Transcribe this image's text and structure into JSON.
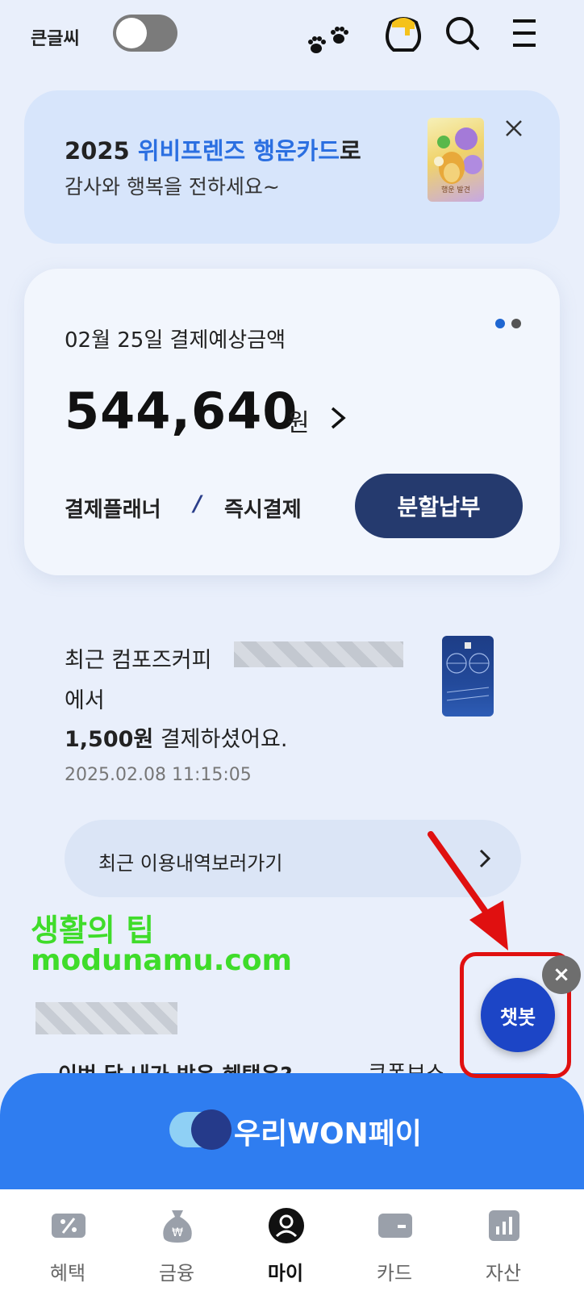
{
  "header": {
    "bigfont_label": "큰글씨",
    "bigfont_toggle_on": false
  },
  "banner": {
    "line1_prefix": "2025 ",
    "line1_highlight": "위비프렌즈 행운카드",
    "line1_suffix": "로",
    "line2": "감사와 행복을 전하세요~",
    "card_art_text": "행운 발견"
  },
  "payment": {
    "date_label": "02월 25일 결제예상금액",
    "amount": "544,640",
    "unit": "원",
    "planner": "결제플래너",
    "slash": "/",
    "instant": "즉시결제",
    "installment": "분할납부",
    "page_dots": 2,
    "active_dot": 0
  },
  "recent": {
    "line1": "최근 컴포즈커피",
    "line2": "에서",
    "line3_amount": "1,500원",
    "line3_rest": " 결제하셨어요.",
    "time": "2025.02.08 11:15:05",
    "history_label": "최근 이용내역보러가기"
  },
  "overlay": {
    "tip_line1": "생활의 팁",
    "tip_line2": "modunamu.com"
  },
  "chatbot": {
    "label": "챗봇",
    "close": "×"
  },
  "peek": {
    "left": "이번 달 내가 받은 혜택은?",
    "right": "쿠폰보스"
  },
  "wonpay": {
    "label": "우리WON페이"
  },
  "nav": {
    "items": [
      {
        "label": "혜택",
        "icon": "benefit-icon"
      },
      {
        "label": "금융",
        "icon": "money-bag-icon"
      },
      {
        "label": "마이",
        "icon": "user-icon"
      },
      {
        "label": "카드",
        "icon": "card-icon"
      },
      {
        "label": "자산",
        "icon": "chart-icon"
      }
    ],
    "active_index": 2
  },
  "colors": {
    "accent_blue": "#2b6fe1",
    "navy_button": "#253a6e",
    "wonpay_band": "#2f7df0",
    "tip_green": "#3fdc2a",
    "highlight_red": "#e01010"
  }
}
